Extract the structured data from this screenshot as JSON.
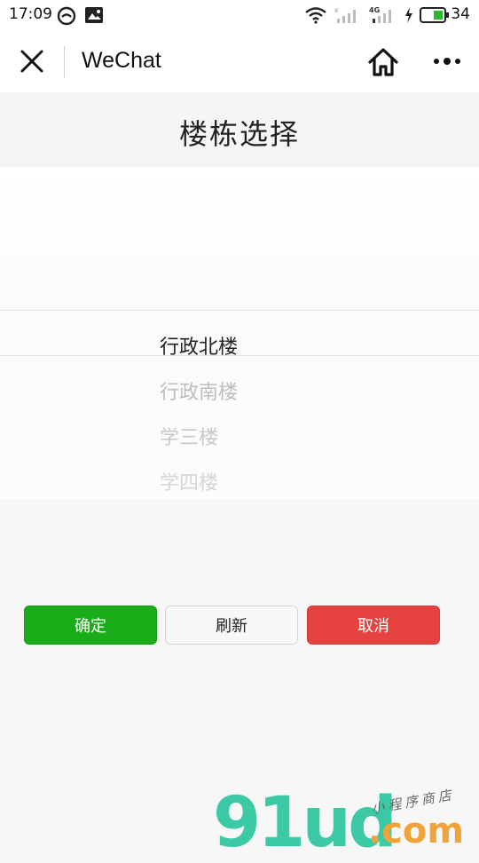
{
  "status_bar": {
    "time": "17:09",
    "battery_level": "34",
    "icons": [
      "wechat-moments-icon",
      "image-icon",
      "wifi-icon",
      "signal-icon",
      "signal-4g-icon",
      "charging-icon",
      "battery-icon"
    ],
    "battery_color": "#2db82d"
  },
  "navbar": {
    "title": "WeChat",
    "close_icon": "close-icon",
    "home_icon": "home-icon",
    "more_icon": "more-icon"
  },
  "page": {
    "title": "楼栋选择"
  },
  "picker": {
    "selected": "行政北楼",
    "options": [
      "行政北楼",
      "行政南楼",
      "学三楼",
      "学四楼"
    ],
    "selected_color": "#222222",
    "option_colors": [
      "#222222",
      "#bdbdbd",
      "#c8c8c8",
      "#d6d6d6"
    ]
  },
  "buttons": {
    "confirm_label": "确定",
    "refresh_label": "刷新",
    "cancel_label": "取消",
    "confirm_color": "#1aad19",
    "cancel_color": "#e64340"
  },
  "watermark": {
    "logo": "91ud",
    "domain": ".com",
    "tagline": "小程序商店"
  }
}
